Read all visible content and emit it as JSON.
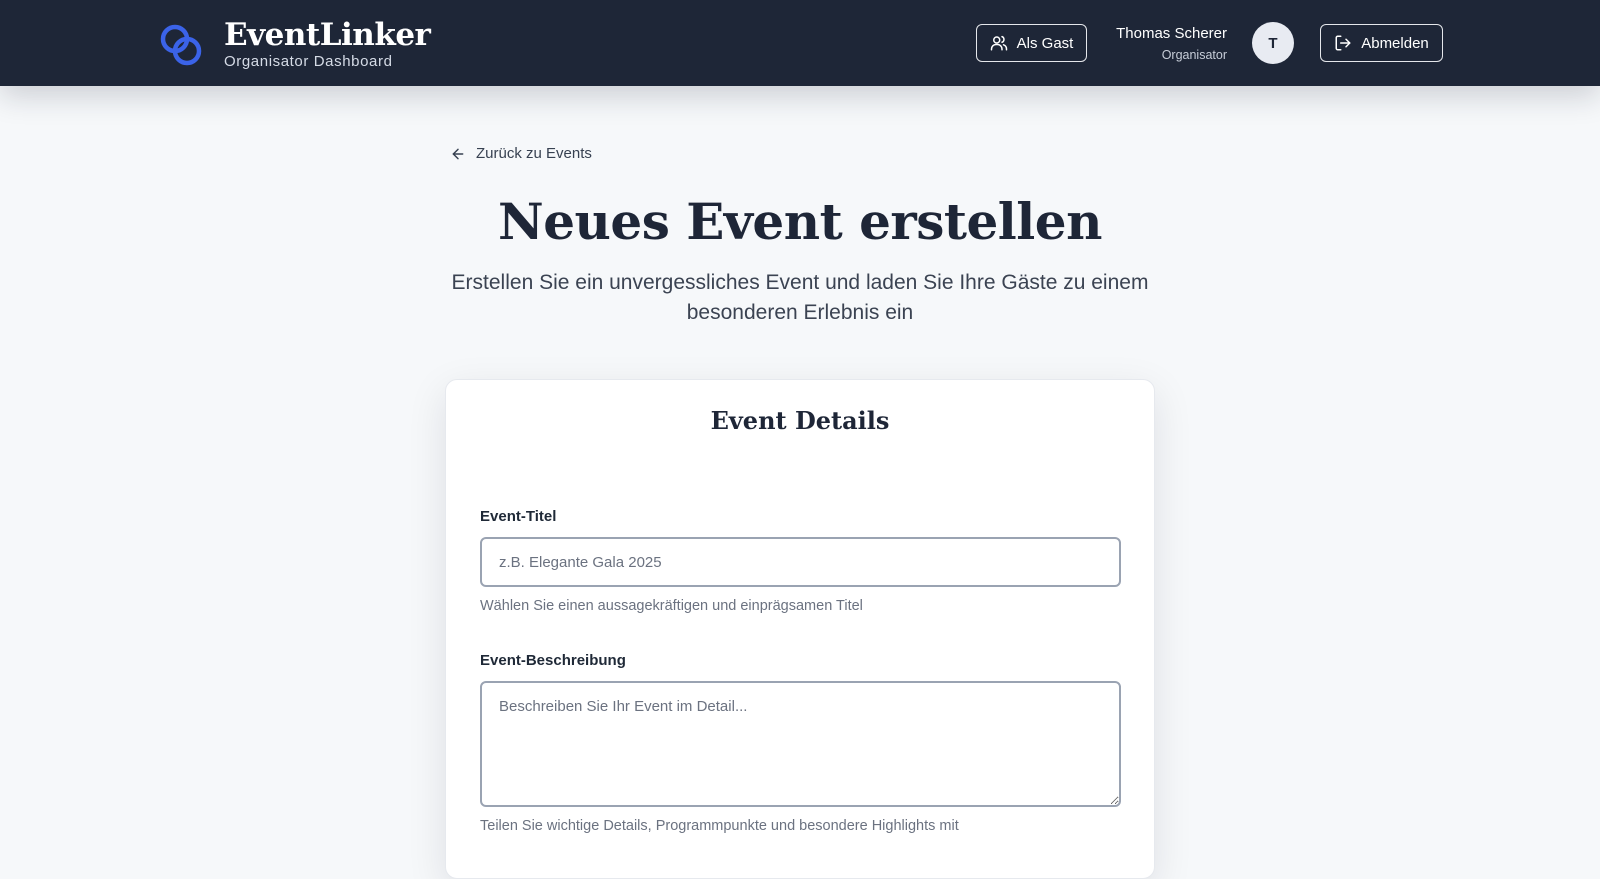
{
  "header": {
    "brand_name": "EventLinker",
    "brand_subtitle": "Organisator Dashboard",
    "guest_button_label": "Als Gast",
    "user_name": "Thomas Scherer",
    "user_role": "Organisator",
    "avatar_initial": "T",
    "logout_button_label": "Abmelden"
  },
  "nav": {
    "back_label": "Zurück zu Events"
  },
  "page": {
    "title": "Neues Event erstellen",
    "subtitle": "Erstellen Sie ein unvergessliches Event und laden Sie Ihre Gäste zu einem besonderen Erlebnis ein"
  },
  "form": {
    "card_title": "Event Details",
    "title_field": {
      "label": "Event-Titel",
      "value": "",
      "placeholder": "z.B. Elegante Gala 2025",
      "help": "Wählen Sie einen aussagekräftigen und einprägsamen Titel"
    },
    "description_field": {
      "label": "Event-Beschreibung",
      "value": "",
      "placeholder": "Beschreiben Sie Ihr Event im Detail...",
      "help": "Teilen Sie wichtige Details, Programmpunkte und besondere Highlights mit"
    }
  },
  "icons": {
    "logo": "linked-rings-icon",
    "guest": "users-icon",
    "logout": "logout-icon",
    "back": "arrow-left-icon"
  },
  "colors": {
    "header_bg": "#1e2637",
    "accent": "#3b63e8",
    "page_bg": "#f6f8fa"
  }
}
